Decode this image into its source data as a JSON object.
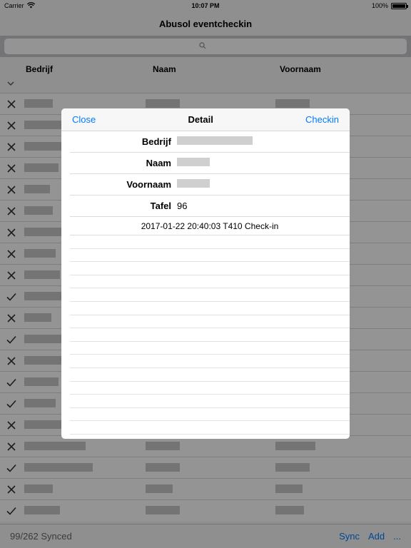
{
  "status_bar": {
    "carrier": "Carrier",
    "time": "10:07 PM",
    "battery": "100%"
  },
  "nav": {
    "title": "Abusol eventcheckin"
  },
  "search": {
    "placeholder": ""
  },
  "table": {
    "headers": {
      "bedrijf": "Bedrijf",
      "naam": "Naam",
      "voornaam": "Voornaam"
    },
    "row_marks": [
      "x",
      "x",
      "x",
      "x",
      "x",
      "x",
      "x",
      "x",
      "x",
      "check",
      "x",
      "check",
      "x",
      "check",
      "check",
      "x",
      "x",
      "check",
      "x",
      "check"
    ]
  },
  "toolbar": {
    "sync_status": "99/262 Synced",
    "sync_label": "Sync",
    "add_label": "Add",
    "more_label": "..."
  },
  "modal": {
    "close_label": "Close",
    "title": "Detail",
    "checkin_label": "Checkin",
    "fields": [
      {
        "label": "Bedrijf",
        "value": ""
      },
      {
        "label": "Naam",
        "value": ""
      },
      {
        "label": "Voornaam",
        "value": ""
      },
      {
        "label": "Tafel",
        "value": "96"
      }
    ],
    "log": [
      "2017-01-22 20:40:03 T410 Check-in"
    ]
  },
  "colors": {
    "accent": "#007aff",
    "overlay": "rgba(0,0,0,0.42)"
  }
}
